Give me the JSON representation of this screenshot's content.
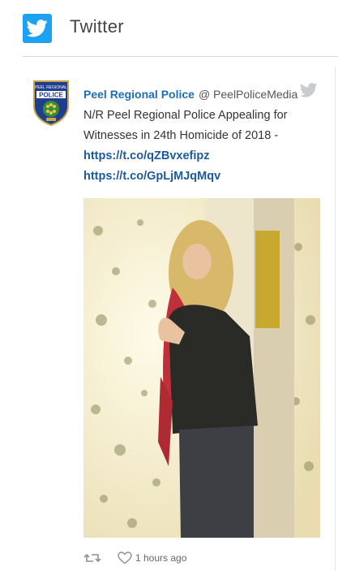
{
  "widget": {
    "title": "Twitter",
    "logo_icon": "twitter-bird-icon",
    "brand_color": "#1da1f2"
  },
  "tweet": {
    "author_name": "Peel Regional Police",
    "author_handle": "@ PeelPoliceMedia",
    "avatar_icon": "peel-regional-police-badge",
    "badge_text": {
      "top": "PEEL REGIONAL",
      "main": "POLICE"
    },
    "text": "N/R Peel Regional Police Appealing for Witnesses in 24th Homicide of 2018 -",
    "links": [
      "https://t.co/qZBvxefipz",
      "https://t.co/GpLjMJqMqv"
    ],
    "link_color": "#1c5a9c",
    "name_color": "#1c6fb4",
    "timestamp": "1 hours ago",
    "actions": [
      "retweet-icon",
      "heart-icon"
    ]
  }
}
